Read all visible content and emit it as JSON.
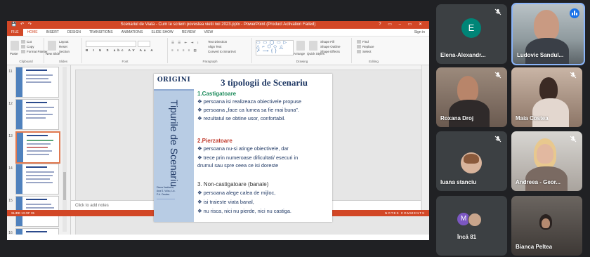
{
  "powerpoint": {
    "window_title": "Scenariul de Viata - Cum te scriem povestea vietii noi 2023.pptx - PowerPoint (Product Activation Failed)",
    "window_controls": "? ▭ – ▭ ✕",
    "sign_in": "Sign in",
    "tabs": [
      "FILE",
      "HOME",
      "INSERT",
      "DESIGN",
      "TRANSITIONS",
      "ANIMATIONS",
      "SLIDE SHOW",
      "REVIEW",
      "VIEW"
    ],
    "active_tab": "HOME",
    "ribbon": {
      "clipboard": {
        "cut": "Cut",
        "copy": "Copy",
        "format_painter": "Format Painter",
        "paste": "Paste",
        "label": "Clipboard"
      },
      "slides": {
        "new_slide": "New Slide",
        "layout": "Layout",
        "reset": "Reset",
        "section": "Section",
        "label": "Slides"
      },
      "font": {
        "label": "Font"
      },
      "paragraph": {
        "label": "Paragraph",
        "text_direction": "Text Direction",
        "align_text": "Align Text",
        "convert": "Convert to SmartArt"
      },
      "drawing": {
        "label": "Drawing",
        "arrange": "Arrange",
        "quick_styles": "Quick Styles",
        "shape_fill": "Shape Fill",
        "shape_outline": "Shape Outline",
        "shape_effects": "Shape Effects"
      },
      "editing": {
        "label": "Editing",
        "find": "Find",
        "replace": "Replace",
        "select": "Select"
      }
    },
    "thumbnails": [
      {
        "num": "11"
      },
      {
        "num": "12"
      },
      {
        "num": "13"
      },
      {
        "num": "14"
      },
      {
        "num": "15"
      },
      {
        "num": "16"
      }
    ],
    "notes_placeholder": "Click to add notes",
    "statusbar_left": "SLIDE 13 OF 35",
    "statusbar_right": "NOTES   COMMENTS"
  },
  "slide": {
    "logo": "ORIGINI",
    "vertical_title": "Tipurile de Scenariu",
    "credits": [
      "Diana Vasilache,",
      "Ana S. Voicu, Lic.",
      "P.A. Oradea"
    ],
    "title": "3 tipologii de Scenariu",
    "section1": {
      "heading": "1.Castigatoare",
      "items": [
        "❖ persoana isi realizeaza obiectivele propuse",
        "❖ persoana „face ca lumea sa fie mai buna”.",
        "❖ rezultatul se obtine usor, confortabil."
      ]
    },
    "section2": {
      "heading": "2.Pierzatoare",
      "items": [
        "❖ persoana nu-si atinge obiectivele, dar",
        "❖ trece prin numeroase dificultati/ esecuri in",
        "   drumul sau spre ceea ce isi doreste"
      ]
    },
    "section3": {
      "heading": "3.  Non-castigatoare (banale)",
      "items": [
        "❖ persoana alege calea de mijloc,",
        "❖ isi traieste viata banal,",
        "❖ nu risca, nici nu pierde, nici nu castiga."
      ]
    }
  },
  "participants": [
    {
      "name": "Elena-Alexandr...",
      "initial": "E",
      "muted": true
    },
    {
      "name": "Ludovic Sandul...",
      "muted": false,
      "speaking": true
    },
    {
      "name": "Roxana Droj",
      "muted": true
    },
    {
      "name": "Maia Costea",
      "muted": true
    },
    {
      "name": "Iuana stanciu",
      "muted": true
    },
    {
      "name": "Andreea - Geor...",
      "muted": true
    },
    {
      "name": "Încă 81",
      "initial": "M"
    },
    {
      "name": "Bianca Peltea"
    }
  ],
  "colors": {
    "ppt_accent": "#d24726",
    "meet_bg": "#202124",
    "tile_bg": "#3c4043",
    "speaking": "#8ab4f8",
    "slide_navy": "#1f3864",
    "green": "#1b8a5a",
    "red": "#c0392b"
  }
}
